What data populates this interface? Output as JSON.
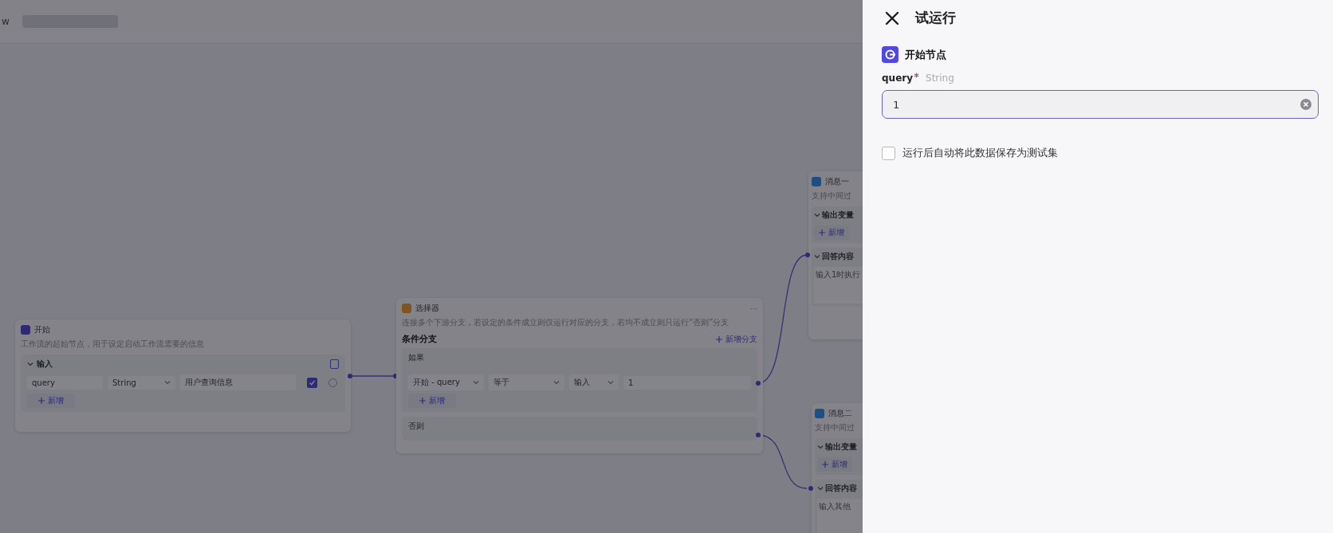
{
  "top_bar": {
    "cut_text": "w"
  },
  "canvas": {
    "start_node": {
      "title": "开始",
      "description": "工作流的起始节点，用于设定启动工作流需要的信息",
      "section": "输入",
      "params": [
        {
          "name": "query",
          "type": "String",
          "description": "用户查询信息",
          "required": true
        }
      ],
      "add_label": "新增"
    },
    "selector_node": {
      "title": "选择器",
      "more": "···",
      "description": "连接多个下游分支，若设定的条件成立则仅运行对应的分支，若均不成立则只运行“否则”分支",
      "section": "条件分支",
      "add_branch": "新增分支",
      "if_label": "如果",
      "conditions": [
        {
          "variable": "开始 - query",
          "operator": "等于",
          "value_kind": "输入",
          "value": "1"
        }
      ],
      "add_label": "新增",
      "else_label": "否则"
    },
    "message_nodes": [
      {
        "title": "消息一",
        "description": "支持中间过",
        "output_section": "输出变量",
        "add_label": "新增",
        "answer_section": "回答内容",
        "answer": "输入1时执行"
      },
      {
        "title": "消息二",
        "description": "支持中间过",
        "output_section": "输出变量",
        "add_label": "新增",
        "answer_section": "回答内容",
        "answer": "输入其他"
      }
    ]
  },
  "run_panel": {
    "title": "试运行",
    "node_title": "开始节点",
    "fields": [
      {
        "name": "query",
        "required": true,
        "type": "String",
        "value": "1"
      }
    ],
    "save_option": {
      "label": "运行后自动将此数据保存为测试集",
      "checked": false
    }
  }
}
